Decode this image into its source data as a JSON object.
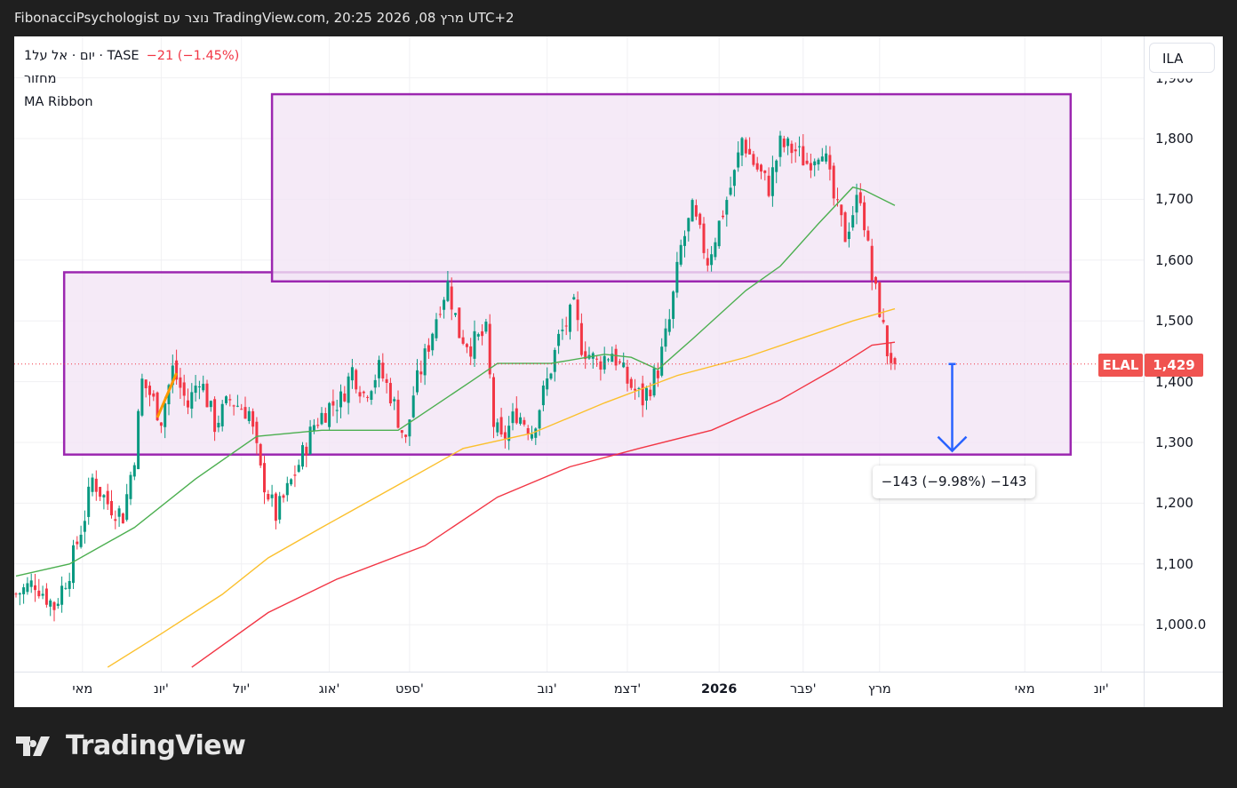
{
  "header": {
    "title": "FibonacciPsychologist נוצר עם TradingView.com, 20:25 2026 ,08 מרץ UTC+2"
  },
  "legend": {
    "symbol_line": "1יום · אל על · TASE",
    "change": "−21 (−1.45%)",
    "volume_label": "מחזור",
    "indicator_label": "MA Ribbon"
  },
  "price_scale": {
    "currency": "ILA",
    "tag_symbol": "ELAL",
    "tag_price": "1,429"
  },
  "measure": {
    "label": "−143 (−9.98%) −143"
  },
  "logo": {
    "text": "TradingView"
  },
  "colors": {
    "up": "#089981",
    "down": "#f23645",
    "box_stroke": "#9c27b0",
    "box_fill": "#f3e5f5",
    "ma_fast": "#4caf50",
    "ma_mid": "#fbc02d",
    "ma_slow": "#f23645",
    "arrow": "#2962ff",
    "trend": "#ff9800"
  },
  "chart_data": {
    "type": "candlestick",
    "title": "ELAL · TASE · 1D",
    "ylim": [
      900,
      1940
    ],
    "yticks": [
      {
        "v": 1900,
        "label": "1,900"
      },
      {
        "v": 1800,
        "label": "1,800"
      },
      {
        "v": 1700,
        "label": "1,700"
      },
      {
        "v": 1600,
        "label": "1,600"
      },
      {
        "v": 1500,
        "label": "1,500"
      },
      {
        "v": 1400,
        "label": "1,400"
      },
      {
        "v": 1300,
        "label": "1,300"
      },
      {
        "v": 1200,
        "label": "1,200"
      },
      {
        "v": 1100,
        "label": "1,100"
      },
      {
        "v": 1000,
        "label": "1,000.0"
      }
    ],
    "xticks": [
      {
        "bar": 17.4,
        "label": "מאי"
      },
      {
        "bar": 38,
        "label": "יונ'"
      },
      {
        "bar": 59,
        "label": "יול'"
      },
      {
        "bar": 82,
        "label": "אוג'"
      },
      {
        "bar": 103,
        "label": "ספט'"
      },
      {
        "bar": 139,
        "label": "נוב'"
      },
      {
        "bar": 160,
        "label": "דצמ'"
      },
      {
        "bar": 184,
        "label": "2026",
        "bold": true
      },
      {
        "bar": 206,
        "label": "פבר'"
      },
      {
        "bar": 226,
        "label": "מרץ"
      },
      {
        "bar": 264,
        "label": "מאי"
      },
      {
        "bar": 284,
        "label": "יונ'"
      }
    ],
    "close_path": [
      [
        0,
        1050
      ],
      [
        5,
        1070
      ],
      [
        10,
        1030
      ],
      [
        14,
        1090
      ],
      [
        18,
        1180
      ],
      [
        20,
        1240
      ],
      [
        24,
        1200
      ],
      [
        28,
        1180
      ],
      [
        31,
        1280
      ],
      [
        33,
        1400
      ],
      [
        35,
        1380
      ],
      [
        38,
        1340
      ],
      [
        41,
        1420
      ],
      [
        45,
        1360
      ],
      [
        48,
        1410
      ],
      [
        52,
        1330
      ],
      [
        56,
        1370
      ],
      [
        61,
        1350
      ],
      [
        64,
        1250
      ],
      [
        68,
        1180
      ],
      [
        71,
        1220
      ],
      [
        75,
        1280
      ],
      [
        78,
        1330
      ],
      [
        82,
        1360
      ],
      [
        85,
        1370
      ],
      [
        88,
        1420
      ],
      [
        91,
        1380
      ],
      [
        95,
        1420
      ],
      [
        98,
        1380
      ],
      [
        102,
        1300
      ],
      [
        104,
        1380
      ],
      [
        107,
        1440
      ],
      [
        111,
        1530
      ],
      [
        113,
        1560
      ],
      [
        116,
        1480
      ],
      [
        119,
        1460
      ],
      [
        123,
        1480
      ],
      [
        125,
        1330
      ],
      [
        127,
        1300
      ],
      [
        131,
        1350
      ],
      [
        135,
        1320
      ],
      [
        139,
        1400
      ],
      [
        142,
        1470
      ],
      [
        146,
        1520
      ],
      [
        148,
        1460
      ],
      [
        152,
        1430
      ],
      [
        156,
        1450
      ],
      [
        160,
        1400
      ],
      [
        164,
        1370
      ],
      [
        168,
        1420
      ],
      [
        171,
        1500
      ],
      [
        174,
        1620
      ],
      [
        177,
        1680
      ],
      [
        181,
        1600
      ],
      [
        184,
        1660
      ],
      [
        188,
        1740
      ],
      [
        190,
        1800
      ],
      [
        193,
        1760
      ],
      [
        197,
        1720
      ],
      [
        200,
        1790
      ],
      [
        204,
        1780
      ],
      [
        207,
        1760
      ],
      [
        211,
        1790
      ],
      [
        214,
        1700
      ],
      [
        217,
        1640
      ],
      [
        219,
        1680
      ],
      [
        221,
        1710
      ],
      [
        224,
        1570
      ],
      [
        226,
        1520
      ],
      [
        228,
        1450
      ],
      [
        230,
        1429
      ]
    ],
    "ma_fast": [
      [
        0,
        1080
      ],
      [
        14,
        1100
      ],
      [
        31,
        1160
      ],
      [
        47,
        1240
      ],
      [
        63,
        1310
      ],
      [
        80,
        1320
      ],
      [
        100,
        1320
      ],
      [
        119,
        1400
      ],
      [
        126,
        1430
      ],
      [
        140,
        1430
      ],
      [
        154,
        1445
      ],
      [
        161,
        1440
      ],
      [
        168,
        1420
      ],
      [
        177,
        1470
      ],
      [
        191,
        1550
      ],
      [
        200,
        1590
      ],
      [
        210,
        1660
      ],
      [
        219,
        1720
      ],
      [
        222,
        1715
      ],
      [
        230,
        1690
      ]
    ],
    "ma_mid": [
      [
        24,
        930
      ],
      [
        38,
        985
      ],
      [
        54,
        1050
      ],
      [
        66,
        1110
      ],
      [
        80,
        1160
      ],
      [
        100,
        1230
      ],
      [
        117,
        1290
      ],
      [
        135,
        1315
      ],
      [
        154,
        1365
      ],
      [
        173,
        1410
      ],
      [
        191,
        1440
      ],
      [
        205,
        1470
      ],
      [
        219,
        1500
      ],
      [
        230,
        1520
      ]
    ],
    "ma_slow": [
      [
        46,
        930
      ],
      [
        66,
        1020
      ],
      [
        84,
        1075
      ],
      [
        107,
        1130
      ],
      [
        126,
        1210
      ],
      [
        145,
        1260
      ],
      [
        163,
        1290
      ],
      [
        182,
        1320
      ],
      [
        200,
        1370
      ],
      [
        214,
        1420
      ],
      [
        224,
        1460
      ],
      [
        230,
        1465
      ]
    ],
    "last_price": 1429,
    "boxes": [
      {
        "bar0": 12.6,
        "bar1": 276,
        "p_top": 1580,
        "p_bot": 1280
      },
      {
        "bar0": 67,
        "bar1": 276,
        "p_top": 1873,
        "p_bot": 1565
      }
    ],
    "trend_line": {
      "bar0": 37,
      "p0": 1341,
      "bar1": 42,
      "p1": 1414
    },
    "measure_arrow": {
      "bar": 245,
      "from": 1429,
      "to": 1286,
      "change": -143,
      "pct": -9.98
    }
  }
}
